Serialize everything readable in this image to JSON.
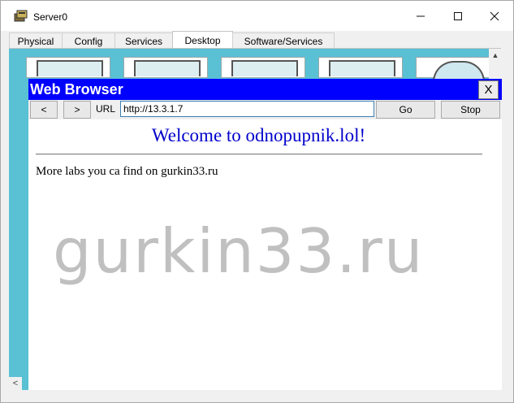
{
  "window": {
    "title": "Server0",
    "icons": [
      "server-app-icon",
      "minimize-icon",
      "maximize-icon",
      "close-icon"
    ]
  },
  "tabs": [
    {
      "label": "Physical",
      "active": false
    },
    {
      "label": "Config",
      "active": false
    },
    {
      "label": "Services",
      "active": false
    },
    {
      "label": "Desktop",
      "active": true
    },
    {
      "label": "Software/Services",
      "active": false
    }
  ],
  "browser": {
    "title": "Web Browser",
    "close_label": "X",
    "back_label": "<",
    "forward_label": ">",
    "url_label": "URL",
    "url_value": "http://13.3.1.7",
    "go_label": "Go",
    "stop_label": "Stop",
    "header_color": "#0000ff"
  },
  "page": {
    "heading": "Welcome to odnopupnik.lol!",
    "text": "More labs you ca find on gurkin33.ru",
    "watermark": "gurkin33.ru",
    "heading_color": "#0000cc"
  },
  "desktop_background": "#5ac0d4"
}
